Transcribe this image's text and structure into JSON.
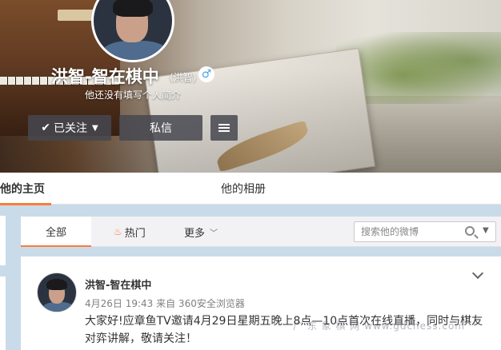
{
  "profile": {
    "name": "洪智-智在棋中",
    "remark": "(洪智)",
    "gender_symbol": "♂",
    "bio": "他还没有填写个人简介",
    "buttons": {
      "follow_label": "已关注",
      "message_label": "私信"
    }
  },
  "tabs": {
    "home": "他的主页",
    "album": "他的相册"
  },
  "filter": {
    "all": "全部",
    "hot": "热门",
    "more": "更多",
    "search_placeholder": "搜索他的微博"
  },
  "post": {
    "author": "洪智-智在棋中",
    "meta": "4月26日 19:43 来自 360安全浏览器",
    "body": "大家好!应章鱼TV邀请4月29日星期五晚上8点—10点首次在线直播，同时与棋友对弈讲解，敬请关注！"
  },
  "watermark": "广 东 象 棋 网  www.gdchess.com",
  "colors": {
    "accent": "#fa7d3c",
    "gender": "#4aa3e8",
    "page_bg": "#c9dbe8"
  },
  "icons": [
    "check-icon",
    "caret-down-icon",
    "menu-icon",
    "flame-icon",
    "chevron-down-icon",
    "search-icon",
    "male-icon"
  ]
}
